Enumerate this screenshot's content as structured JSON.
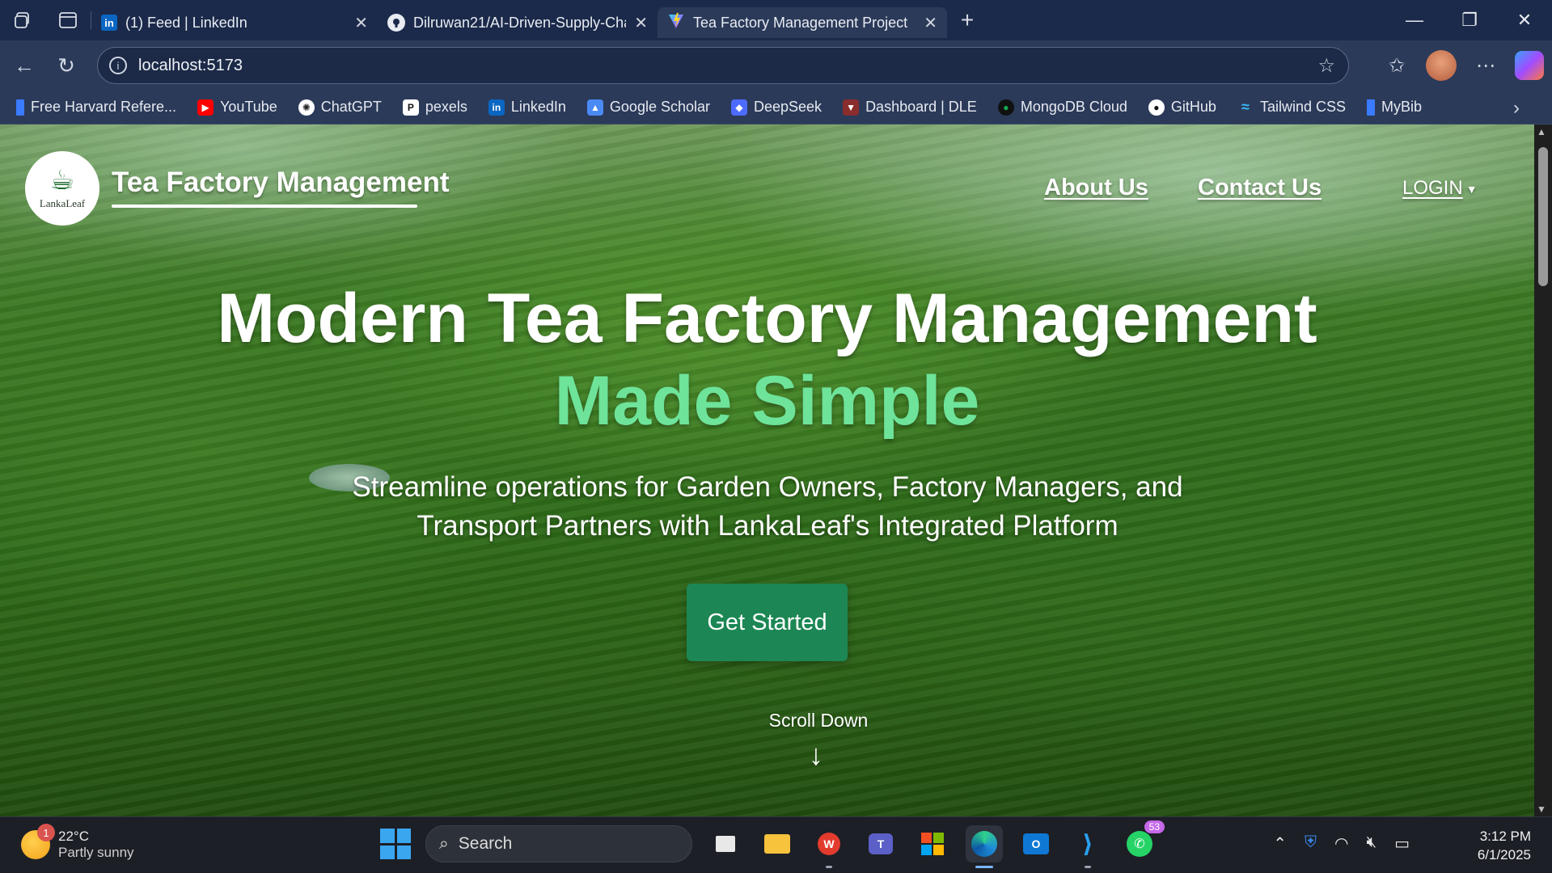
{
  "browser": {
    "tabs": [
      {
        "title": "(1) Feed | LinkedIn",
        "icon": "linkedin-icon",
        "active": false
      },
      {
        "title": "Dilruwan21/AI-Driven-Supply-Cha",
        "icon": "github-icon",
        "active": false
      },
      {
        "title": "Tea Factory Management Project",
        "icon": "vite-icon",
        "active": true
      }
    ],
    "url": "localhost:5173",
    "bookmarks": [
      "Free Harvard Refere...",
      "YouTube",
      "ChatGPT",
      "pexels",
      "LinkedIn",
      "Google Scholar",
      "DeepSeek",
      "Dashboard | DLE",
      "MongoDB Cloud",
      "GitHub",
      "Tailwind CSS",
      "MyBib"
    ]
  },
  "site": {
    "logo_text": "LankaLeaf",
    "brand": "Tea Factory Management",
    "nav": {
      "about": "About Us",
      "contact": "Contact Us",
      "login": "LOGIN"
    },
    "hero": {
      "title": "Modern Tea Factory Management",
      "accent": "Made Simple",
      "subtitle_line1": "Streamline operations for Garden Owners, Factory Managers, and",
      "subtitle_line2": "Transport Partners with LankaLeaf's Integrated Platform",
      "cta": "Get Started",
      "scroll": "Scroll Down"
    },
    "colors": {
      "accent_green": "#6ee39a",
      "cta_green": "#1c8754"
    }
  },
  "taskbar": {
    "weather_temp": "22°C",
    "weather_desc": "Partly sunny",
    "weather_badge": "1",
    "search_placeholder": "Search",
    "whatsapp_count": "53",
    "time": "3:12 PM",
    "date": "6/1/2025"
  }
}
